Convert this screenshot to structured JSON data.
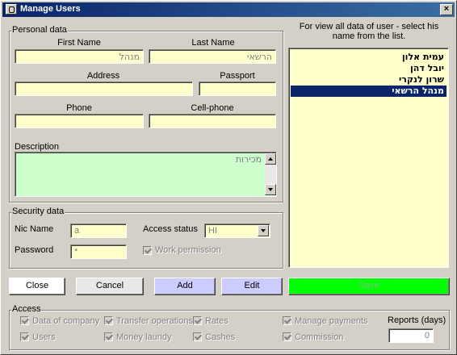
{
  "window": {
    "title": "Manage Users",
    "close_glyph": "×"
  },
  "personal": {
    "legend": "Personal data",
    "first_name_label": "First Name",
    "last_name_label": "Last Name",
    "first_name_value": "מנהל",
    "last_name_value": "הרשאי",
    "address_label": "Address",
    "passport_label": "Passport",
    "phone_label": "Phone",
    "cellphone_label": "Cell-phone",
    "description_label": "Description",
    "description_value": "מכירות"
  },
  "security": {
    "legend": "Security data",
    "nic_label": "Nic Name",
    "nic_value": "a",
    "password_label": "Password",
    "password_value": "*",
    "access_status_label": "Access status",
    "access_status_value": "HI",
    "work_permission_label": "Work permission"
  },
  "users": {
    "hint": "For view all data of user - select his name from the list.",
    "items": [
      "עמית אלון",
      "יובל דהן",
      "שרון לנקרי",
      "מנהל הרשאי"
    ],
    "selected_index": 3
  },
  "buttons": {
    "close": "Close",
    "cancel": "Cancel",
    "add": "Add",
    "edit": "Edit",
    "save": "Save"
  },
  "access": {
    "legend": "Access",
    "items": [
      "Data of company",
      "Users",
      "Transfer operations",
      "Money laundy",
      "Rates",
      "Cashes",
      "Manage payments",
      "Commission"
    ],
    "reports_label": "Reports (days)",
    "reports_value": "0"
  },
  "colors": {
    "title_bar": "#0a246a",
    "field_bg": "#ffffcc",
    "description_bg": "#ccffcc",
    "save_bg": "#00ff00",
    "add_edit_bg": "#ccccff"
  }
}
